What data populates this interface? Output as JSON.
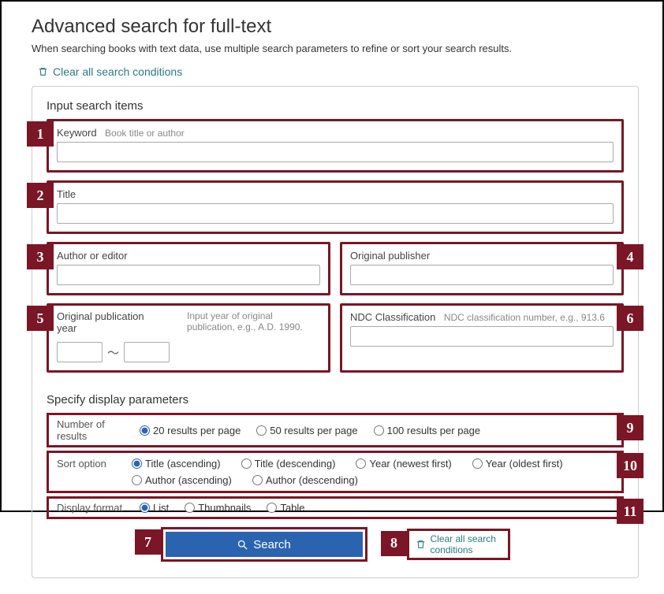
{
  "heading": "Advanced search for full-text",
  "subtitle": "When searching books with text data, use multiple search parameters to refine or sort your search results.",
  "clear_all_label": "Clear all search conditions",
  "section_input": "Input search items",
  "keyword": {
    "label": "Keyword",
    "hint": "Book title or author",
    "value": ""
  },
  "title": {
    "label": "Title",
    "value": ""
  },
  "author": {
    "label": "Author or editor",
    "value": ""
  },
  "publisher": {
    "label": "Original publisher",
    "value": ""
  },
  "pubyear": {
    "label": "Original publication year",
    "hint": "Input year of original publication, e.g., A.D. 1990.",
    "from": "",
    "to": ""
  },
  "ndc": {
    "label": "NDC Classification",
    "hint": "NDC classification number, e.g., 913.6",
    "value": ""
  },
  "section_display": "Specify display parameters",
  "num_results": {
    "label": "Number of results",
    "options": [
      "20 results per page",
      "50 results per page",
      "100 results per page"
    ],
    "selected": 0
  },
  "sort": {
    "label": "Sort option",
    "options": [
      "Title (ascending)",
      "Title (descending)",
      "Year (newest first)",
      "Year (oldest first)",
      "Author (ascending)",
      "Author (descending)"
    ],
    "selected": 0
  },
  "display_fmt": {
    "label": "Display format",
    "options": [
      "List",
      "Thumbnails",
      "Table"
    ],
    "selected": 0
  },
  "search_button": "Search",
  "clear_bottom": "Clear all search conditions",
  "badges": {
    "b1": "1",
    "b2": "2",
    "b3": "3",
    "b4": "4",
    "b5": "5",
    "b6": "6",
    "b7": "7",
    "b8": "8",
    "b9": "9",
    "b10": "10",
    "b11": "11"
  }
}
